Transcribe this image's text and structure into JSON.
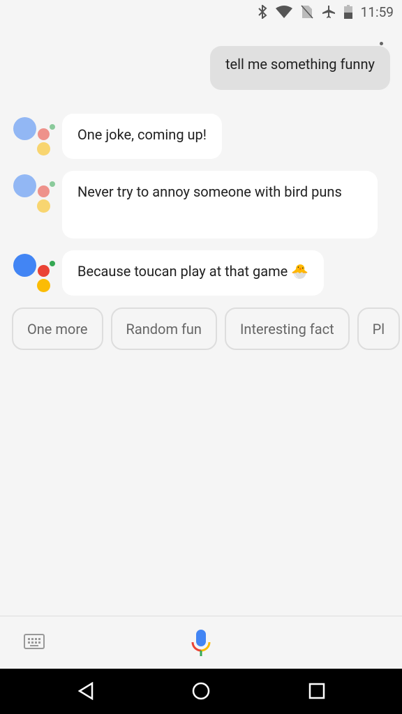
{
  "status_bar": {
    "time": "11:59",
    "icons": [
      "bluetooth-icon",
      "wifi-icon",
      "no-sim-icon",
      "airplane-icon",
      "battery-icon"
    ]
  },
  "user_message": "tell me something funny",
  "assistant_messages": [
    {
      "text": "One joke, coming up!",
      "active": false
    },
    {
      "text": "Never try to annoy someone with bird puns",
      "active": false
    },
    {
      "text": "Because toucan play at that game 🐣",
      "active": true
    }
  ],
  "suggestions": [
    "One more",
    "Random fun",
    "Interesting fact",
    "Pl"
  ],
  "colors": {
    "blue": "#4285f4",
    "red": "#ea4335",
    "yellow": "#fbbc05",
    "green": "#34a853"
  }
}
